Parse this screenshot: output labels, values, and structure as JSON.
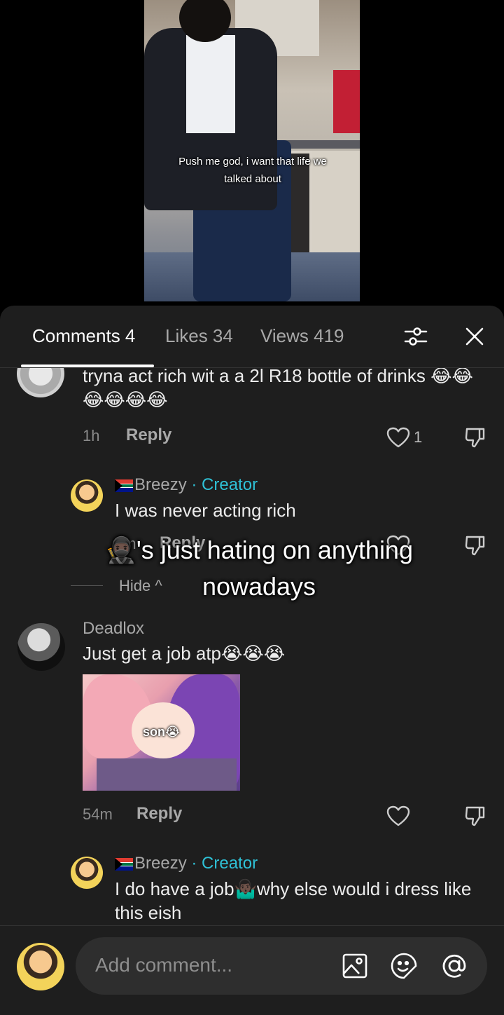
{
  "video": {
    "caption": "Push me god, i want that life we talked about"
  },
  "tabs": {
    "comments_label": "Comments 4",
    "likes_label": "Likes 34",
    "views_label": "Views 419"
  },
  "comments": [
    {
      "text": "tryna act rich wit a a 2l R18 bottle of drinks 😂😂😂😂😂😂",
      "time": "1h",
      "reply_label": "Reply",
      "like_count": "1"
    },
    {
      "username": "Breezy",
      "creator_label": "· Creator",
      "text": "I was never acting rich",
      "time": "2m",
      "reply_label": "Reply",
      "hide_label": "Hide ^"
    },
    {
      "username": "Deadlox",
      "text": "Just get a job atp😭😭😭",
      "sticker_text": "son😭",
      "time": "54m",
      "reply_label": "Reply"
    },
    {
      "username": "Breezy",
      "creator_label": "· Creator",
      "text": "I do have a job🤷🏿‍♂️why else would i dress like this eish"
    }
  ],
  "overlay": {
    "line1": "🥷🏿's just hating on anything",
    "line2": "nowadays"
  },
  "composer": {
    "placeholder": "Add comment..."
  },
  "colors": {
    "sheet_bg": "#1e1e1e",
    "creator_accent": "#2fc1d6"
  }
}
